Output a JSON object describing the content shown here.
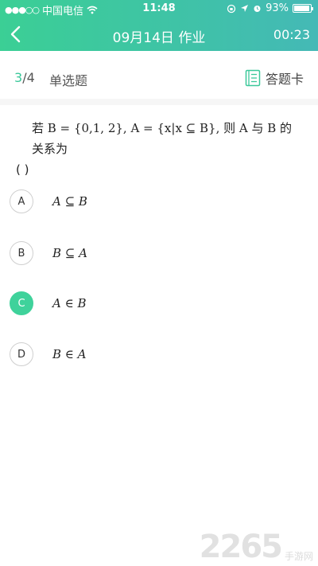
{
  "status": {
    "carrier": "中国电信",
    "time": "11:48",
    "battery": "93%",
    "battery_level": 0.93
  },
  "nav": {
    "title": "09月14日 作业",
    "timer": "00:23"
  },
  "quiz": {
    "current": "3",
    "separator": "/",
    "total": "4",
    "type": "单选题",
    "answer_card": "答题卡"
  },
  "question": {
    "text_line1": "若 B = {0,1, 2}, A = {x|x ⊆ B}, 则 A 与 B 的关系为",
    "text_line2": "(   )"
  },
  "options": [
    {
      "letter": "A",
      "text": "A ⊆ B",
      "selected": false
    },
    {
      "letter": "B",
      "text": "B ⊆ A",
      "selected": false
    },
    {
      "letter": "C",
      "text": "A ∈ B",
      "selected": true
    },
    {
      "letter": "D",
      "text": "B ∈ A",
      "selected": false
    }
  ],
  "colors": {
    "header_start": "#3bcf95",
    "header_end": "#44b9b6",
    "accent": "#3bc89a",
    "selected": "#3fd29b"
  },
  "watermark": {
    "brand": "2265",
    "sub": "手游网"
  }
}
